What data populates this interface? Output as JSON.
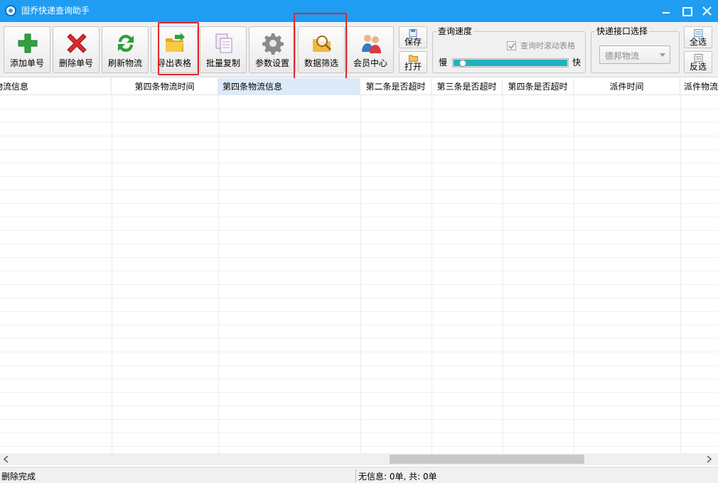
{
  "window": {
    "title": "固乔快递查询助手"
  },
  "toolbar": {
    "buttons": [
      {
        "label": "添加单号",
        "icon": "plus-icon",
        "color": "#2fa33a"
      },
      {
        "label": "删除单号",
        "icon": "x-icon",
        "color": "#d92b2b"
      },
      {
        "label": "刷新物流",
        "icon": "refresh-icon",
        "color": "#2f9e3a"
      },
      {
        "label": "导出表格",
        "icon": "folder-export-icon",
        "color": "#f0b429"
      },
      {
        "label": "批量复制",
        "icon": "copy-icon",
        "color": "#c9a0d6"
      },
      {
        "label": "参数设置",
        "icon": "gear-icon",
        "color": "#7a7a7a"
      },
      {
        "label": "数据筛选",
        "icon": "search-filter-icon",
        "color": "#f0b429"
      },
      {
        "label": "会员中心",
        "icon": "users-icon",
        "color": "#3b77c9"
      }
    ],
    "save_label": "保存",
    "open_label": "打开",
    "select_all_label": "全选",
    "invert_label": "反选"
  },
  "speed": {
    "group_title": "查询速度",
    "checkbox_label": "查询时滚动表格",
    "checked": true,
    "slow_label": "慢",
    "fast_label": "快",
    "level": 0.05
  },
  "courier": {
    "group_title": "快递接口选择",
    "selected": "德邦物流"
  },
  "grid": {
    "columns": [
      {
        "label": "物流信息"
      },
      {
        "label": "第四条物流时间"
      },
      {
        "label": "第四条物流信息",
        "selected": true
      },
      {
        "label": "第二条是否超时"
      },
      {
        "label": "第三条是否超时"
      },
      {
        "label": "第四条是否超时"
      },
      {
        "label": "派件时间"
      },
      {
        "label": "派件物流"
      }
    ],
    "rows": []
  },
  "statusbar": {
    "left": "删除完成",
    "right": "无信息: 0单, 共: 0单"
  },
  "colors": {
    "titlebar": "#1e9df2",
    "highlight": "#e0262c",
    "speed_fill": "#1fb2bd"
  }
}
